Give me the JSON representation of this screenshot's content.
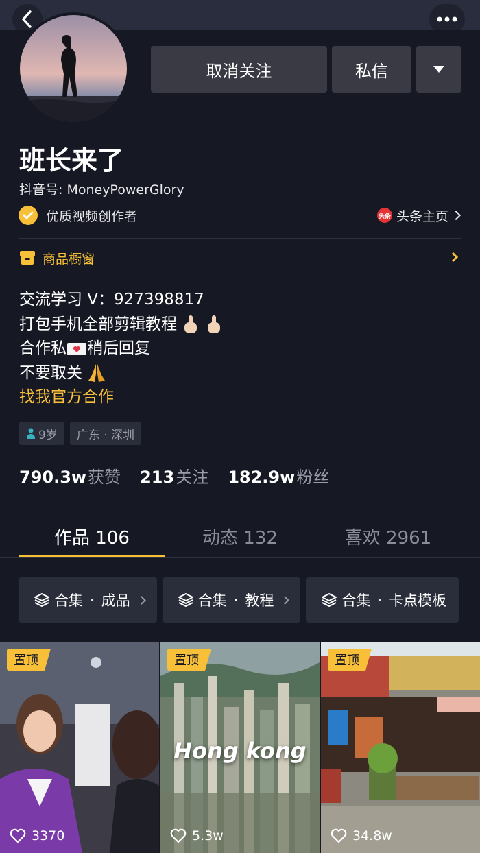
{
  "header": {
    "back_icon": "chevron-left-icon",
    "more_icon": "more-dots-icon"
  },
  "profile": {
    "name": "班长来了",
    "douyin_id": "抖音号: MoneyPowerGlory",
    "certification": "优质视频创作者",
    "toutiao_badge": "头条",
    "toutiao_link": "头条主页",
    "shop_label": "商品橱窗",
    "bio": {
      "line1": "交流学习 V：927398817",
      "line2": "打包手机全部剪辑教程",
      "line3a": "合作私",
      "line3b": "稍后回复",
      "line4": "不要取关",
      "link": "找我官方合作"
    },
    "tags": {
      "age": "9岁",
      "location": "广东 · 深圳"
    }
  },
  "actions": {
    "unfollow": "取消关注",
    "message": "私信"
  },
  "stats": [
    {
      "num": "790.3w",
      "label": "获赞"
    },
    {
      "num": "213",
      "label": "关注"
    },
    {
      "num": "182.9w",
      "label": "粉丝"
    }
  ],
  "tabs": [
    {
      "label": "作品 106"
    },
    {
      "label": "动态 132"
    },
    {
      "label": "喜欢 2961"
    }
  ],
  "collections": [
    {
      "a": "合集",
      "b": "成品"
    },
    {
      "a": "合集",
      "b": "教程"
    },
    {
      "a": "合集",
      "b": "卡点模板"
    }
  ],
  "videos": [
    {
      "pin": "置顶",
      "likes": "3370"
    },
    {
      "pin": "置顶",
      "likes": "5.3w",
      "overlay": "Hong kong"
    },
    {
      "pin": "置顶",
      "likes": "34.8w"
    }
  ],
  "colors": {
    "background": "#161823",
    "accent": "#f8c039",
    "button": "#3a3a45",
    "muted": "#9b9da6"
  }
}
